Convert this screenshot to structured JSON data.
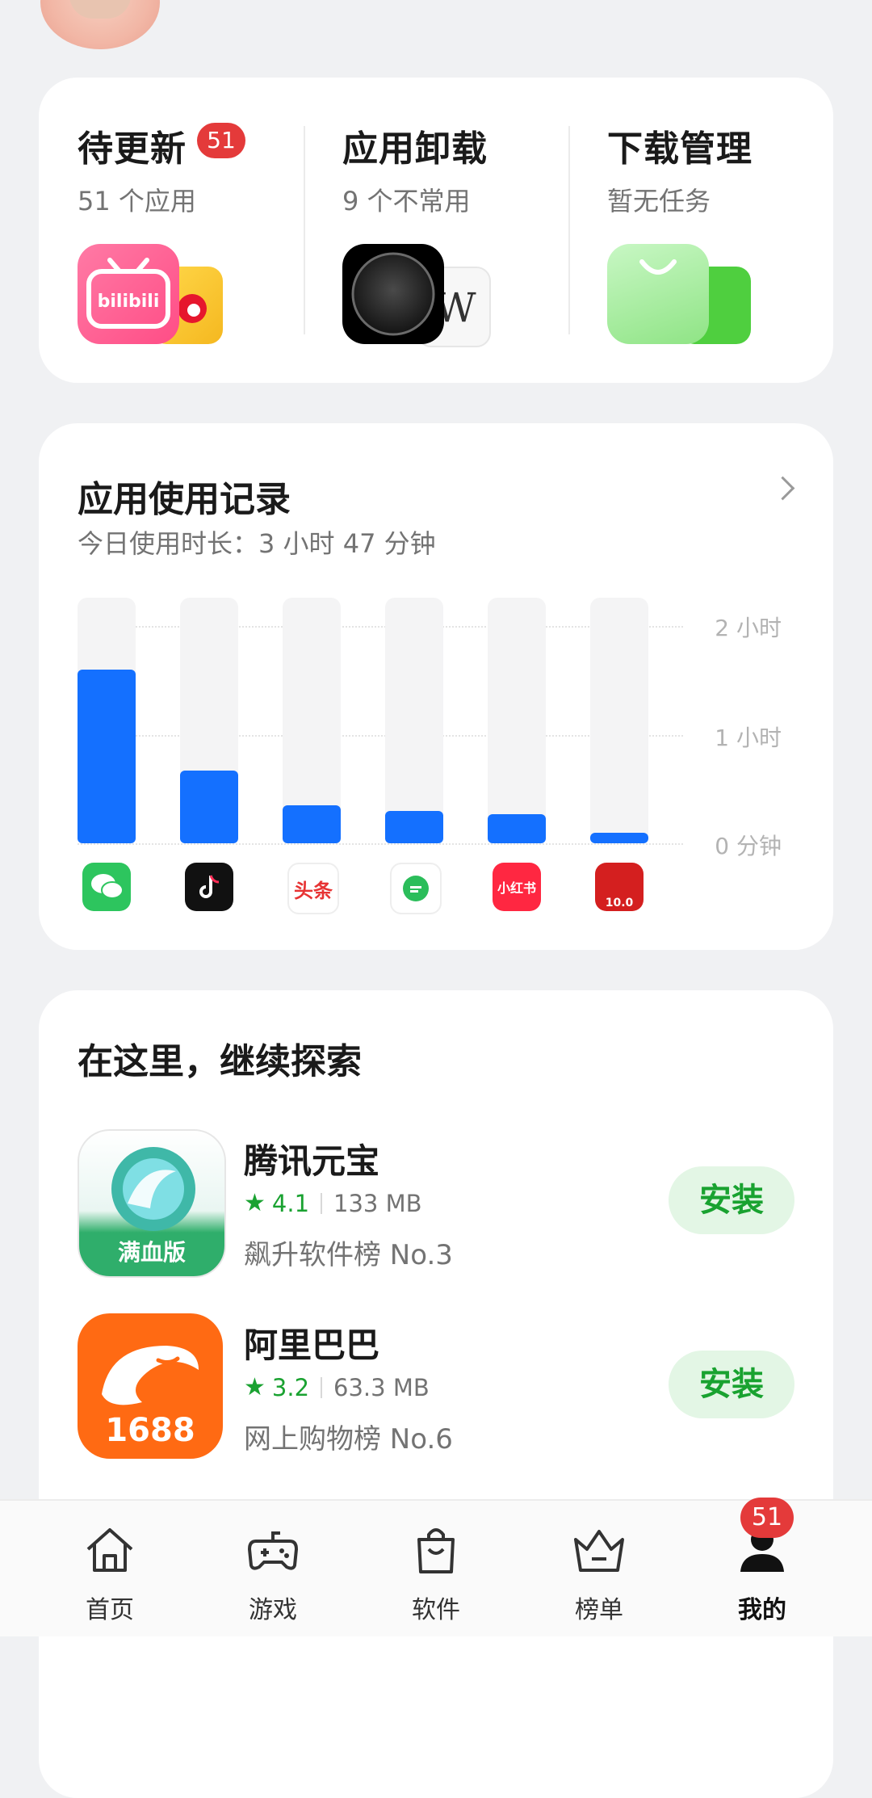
{
  "header": {
    "avatar": "user-avatar"
  },
  "quick_actions": [
    {
      "title": "待更新",
      "badge": "51",
      "subtitle": "51 个应用"
    },
    {
      "title": "应用卸载",
      "subtitle": "9 个不常用"
    },
    {
      "title": "下载管理",
      "subtitle": "暂无任务"
    }
  ],
  "usage": {
    "title": "应用使用记录",
    "summary": "今日使用时长：3 小时 47 分钟",
    "chart_data": {
      "type": "bar",
      "categories": [
        "微信",
        "抖音",
        "今日头条",
        "信息",
        "小红书",
        "工商银行"
      ],
      "values": [
        96,
        40,
        21,
        18,
        16,
        6
      ],
      "unit": "分钟",
      "ylim": [
        0,
        120
      ],
      "y_ticks": [
        "0 分钟",
        "1 小时",
        "2 小时"
      ],
      "colors": {
        "bar": "#1470ff",
        "track": "#f4f4f5"
      }
    },
    "icon_labels": {
      "toutiao": "头条",
      "xiaohongshu": "小红书",
      "icbc": "10.0"
    }
  },
  "explore": {
    "title": "在这里，继续探索",
    "apps": [
      {
        "name": "腾讯元宝",
        "rating": "4.1",
        "size": "133 MB",
        "rank": "飙升软件榜 No.3",
        "icon_text": "满血版",
        "button": "安装"
      },
      {
        "name": "阿里巴巴",
        "rating": "3.2",
        "size": "63.3 MB",
        "rank": "网上购物榜 No.6",
        "icon_text": "1688",
        "button": "安装"
      }
    ]
  },
  "bottom_nav": {
    "items": [
      {
        "label": "首页",
        "icon": "home-icon"
      },
      {
        "label": "游戏",
        "icon": "gamepad-icon"
      },
      {
        "label": "软件",
        "icon": "shopping-bag-icon"
      },
      {
        "label": "榜单",
        "icon": "crown-icon"
      },
      {
        "label": "我的",
        "icon": "person-icon",
        "badge": "51",
        "active": true
      }
    ]
  }
}
